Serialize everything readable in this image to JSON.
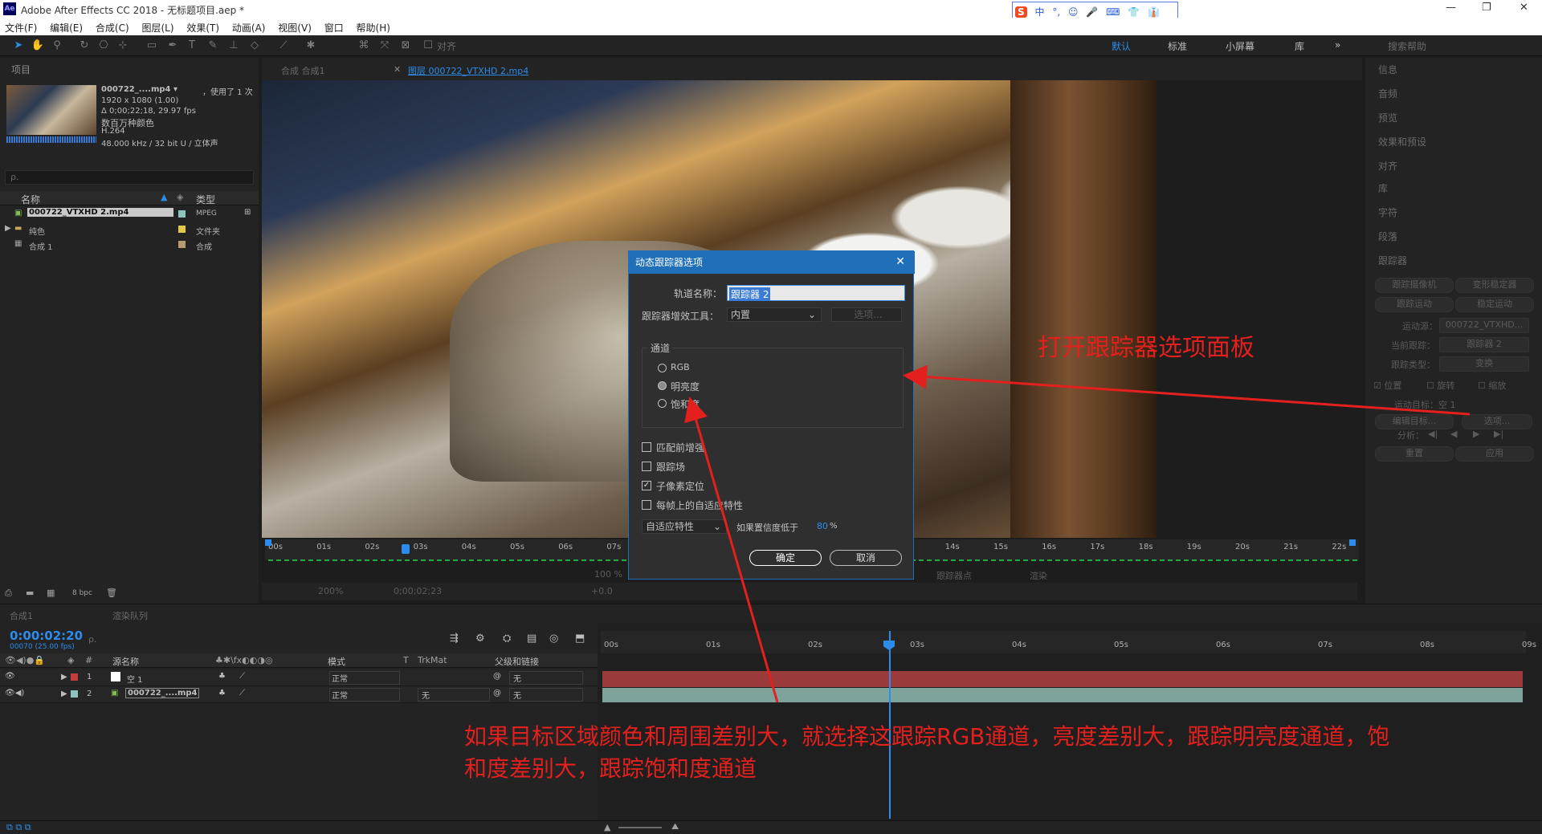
{
  "window": {
    "title": "Adobe After Effects CC 2018 - 无标题项目.aep *",
    "app_icon": "Ae",
    "controls": [
      "—",
      "❐",
      "✕"
    ]
  },
  "ime": {
    "logo": "S",
    "items": [
      "中",
      "°,",
      "☺",
      "🎤",
      "⌨",
      "👕",
      "👔",
      "▦"
    ]
  },
  "menu": [
    "文件(F)",
    "编辑(E)",
    "合成(C)",
    "图层(L)",
    "效果(T)",
    "动画(A)",
    "视图(V)",
    "窗口",
    "帮助(H)"
  ],
  "toolbar": {
    "align_label": "对齐",
    "workspaces": [
      {
        "label": "默认",
        "active": true
      },
      {
        "label": "标准"
      },
      {
        "label": "小屏幕"
      },
      {
        "label": "库"
      }
    ],
    "more": "»",
    "search_placeholder": "搜索帮助"
  },
  "project": {
    "tab": "项目",
    "clip_name": "000722_....mp4 ▾",
    "used": "，使用了 1 次",
    "meta_lines": [
      "1920 x 1080 (1.00)",
      "Δ 0;00;22;18, 29.97 fps",
      "数百万种颜色",
      "H.264",
      "48.000 kHz / 32 bit U / 立体声"
    ],
    "search_placeholder": "ρ.",
    "columns": {
      "name": "名称",
      "type": "类型"
    },
    "items": [
      {
        "name": "000722_VTXHD 2.mp4",
        "type": "MPEG",
        "color": "#8fc3c0",
        "selected": true
      },
      {
        "name": "纯色",
        "type": "文件夹",
        "color": "#e2c84b"
      },
      {
        "name": "合成 1",
        "type": "合成",
        "color": "#b79a70"
      }
    ],
    "bpc": "8 bpc"
  },
  "viewer": {
    "tabs": [
      {
        "label": "合成 合成1"
      },
      {
        "label": "图层 000722_VTXHD 2.mp4",
        "active": true
      }
    ],
    "ruler_labels": [
      "00s",
      "01s",
      "02s",
      "03s",
      "04s",
      "05s",
      "06s",
      "07s",
      "14s",
      "15s",
      "16s",
      "17s",
      "18s",
      "19s",
      "20s",
      "21s",
      "22s"
    ],
    "footer": {
      "zoom": "200%",
      "time": "0;00;02;23",
      "exposure": "+0.0",
      "res": "100 %"
    },
    "footer_right": {
      "view": "跟踪器点",
      "render": "渲染"
    }
  },
  "dialog": {
    "title": "动态跟踪器选项",
    "close": "✕",
    "track_name_label": "轨道名称：",
    "track_name_value": "跟踪器 2",
    "plugin_label": "跟踪器增效工具：",
    "plugin_value": "内置",
    "options_button": "选项...",
    "channel_group_label": "通道",
    "channels": [
      {
        "label": "RGB",
        "selected": false
      },
      {
        "label": "明亮度",
        "selected": true
      },
      {
        "label": "饱和度",
        "selected": false
      }
    ],
    "checks": [
      {
        "label": "匹配前增强",
        "checked": false
      },
      {
        "label": "跟踪场",
        "checked": false
      },
      {
        "label": "子像素定位",
        "checked": true
      },
      {
        "label": "每帧上的自适应特性",
        "checked": false
      }
    ],
    "adapt_select": "自适应特性",
    "confidence_label": "如果置信度低于",
    "confidence_value": "80",
    "confidence_unit": "%",
    "ok": "确定",
    "cancel": "取消"
  },
  "right_panel": {
    "tabs": [
      "信息",
      "音频",
      "预览",
      "效果和预设",
      "对齐",
      "库",
      "字符",
      "段落"
    ],
    "tracker": {
      "title": "跟踪器",
      "buttons": [
        "跟踪摄像机",
        "变形稳定器",
        "跟踪运动",
        "稳定运动"
      ],
      "motion_source_label": "运动源：",
      "motion_source_value": "000722_VTXHD...",
      "current_track_label": "当前跟踪：",
      "current_track_value": "跟踪器 2",
      "track_type_label": "跟踪类型：",
      "track_type_value": "变换",
      "checks": [
        "位置",
        "旋转",
        "缩放"
      ],
      "target_label": "运动目标：空 1",
      "edit_target": "编辑目标...",
      "options": "选项...",
      "analyze_label": "分析：",
      "analyze_icons": [
        "◀|",
        "◀",
        "▶",
        "▶|"
      ],
      "reset": "重置",
      "apply": "应用"
    }
  },
  "timeline": {
    "tabs": [
      "合成1",
      "渲染队列"
    ],
    "timecode": "0:00:02:20",
    "frame_info": "00070 (25.00 fps)",
    "search_placeholder": "ρ.",
    "columns": {
      "num": "#",
      "name": "源名称",
      "mode": "模式",
      "t": "T",
      "trkmat": "TrkMat",
      "parent": "父级和链接"
    },
    "ruler_labels": [
      "00s",
      "01s",
      "02s",
      "03s",
      "04s",
      "05s",
      "06s",
      "07s",
      "08s",
      "09s"
    ],
    "layers": [
      {
        "num": "1",
        "name": "空 1",
        "mode": "正常",
        "trkmat": "",
        "parent": "无",
        "color": "#c33b3b"
      },
      {
        "num": "2",
        "name": "000722_....mp4",
        "mode": "正常",
        "trkmat": "无",
        "parent": "无",
        "color": "#8fc3c0"
      }
    ]
  },
  "annotations": {
    "top": "打开跟踪器选项面板",
    "bottom_line1": "如果目标区域颜色和周围差别大，就选择这跟踪RGB通道，亮度差别大，跟踪明亮度通道，饱",
    "bottom_line2": "和度差别大，跟踪饱和度通道",
    "color": "#e4201e"
  }
}
